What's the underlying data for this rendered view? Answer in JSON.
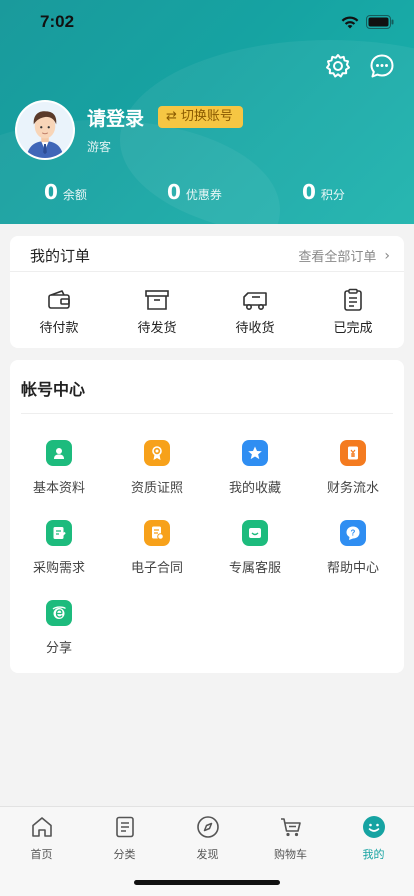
{
  "status": {
    "time": "7:02"
  },
  "header": {
    "login_text": "请登录",
    "switch_label": "切换账号",
    "guest_text": "游客",
    "stats": [
      {
        "value": "0",
        "label": "余额"
      },
      {
        "value": "0",
        "label": "优惠券"
      },
      {
        "value": "0",
        "label": "积分"
      }
    ]
  },
  "orders": {
    "title": "我的订单",
    "view_all": "查看全部订单",
    "items": [
      {
        "label": "待付款",
        "icon": "wallet-icon"
      },
      {
        "label": "待发货",
        "icon": "box-icon"
      },
      {
        "label": "待收货",
        "icon": "truck-icon"
      },
      {
        "label": "已完成",
        "icon": "clipboard-icon"
      }
    ]
  },
  "account": {
    "title": "帐号中心",
    "items": [
      {
        "label": "基本资料",
        "icon": "profile-icon",
        "color": "#1dbb7d"
      },
      {
        "label": "资质证照",
        "icon": "certificate-icon",
        "color": "#f7a11a"
      },
      {
        "label": "我的收藏",
        "icon": "star-icon",
        "color": "#2f8ef2"
      },
      {
        "label": "财务流水",
        "icon": "finance-icon",
        "color": "#f47b20"
      },
      {
        "label": "采购需求",
        "icon": "purchase-icon",
        "color": "#1dbb7d"
      },
      {
        "label": "电子合同",
        "icon": "contract-icon",
        "color": "#f7a11a"
      },
      {
        "label": "专属客服",
        "icon": "chat-icon",
        "color": "#1dbb7d"
      },
      {
        "label": "帮助中心",
        "icon": "help-icon",
        "color": "#2f8ef2"
      },
      {
        "label": "分享",
        "icon": "share-icon",
        "color": "#1dbb7d"
      }
    ]
  },
  "tabbar": {
    "tabs": [
      {
        "label": "首页",
        "icon": "home-icon"
      },
      {
        "label": "分类",
        "icon": "category-icon"
      },
      {
        "label": "发现",
        "icon": "compass-icon"
      },
      {
        "label": "购物车",
        "icon": "cart-icon"
      },
      {
        "label": "我的",
        "icon": "profile-smile-icon",
        "active": true
      }
    ],
    "active_color": "#16a3a2"
  }
}
